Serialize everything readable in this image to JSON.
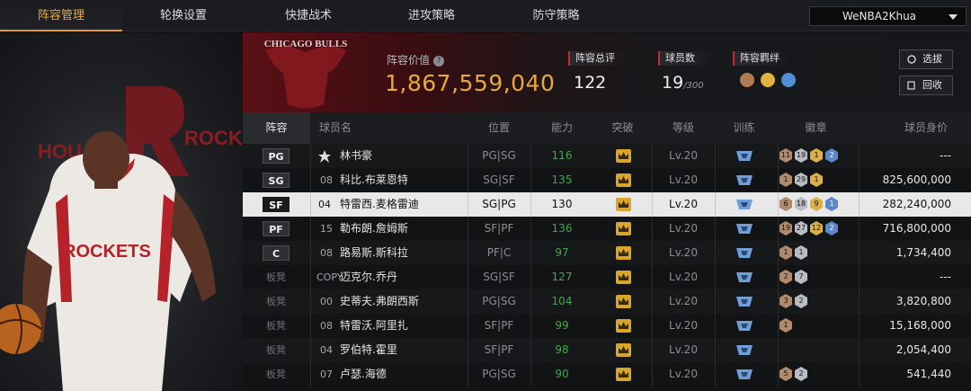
{
  "nav": {
    "tabs": [
      "阵容管理",
      "轮换设置",
      "快捷战术",
      "进攻策略",
      "防守策略"
    ],
    "active_index": 0,
    "user": "WeNBA2Khua"
  },
  "team": {
    "logo_text": "CHICAGO BULLS",
    "value_label": "阵容价值",
    "value": "1,867,559,040",
    "stats": [
      {
        "label": "阵容总评",
        "value": "122",
        "suffix": ""
      },
      {
        "label": "球员数",
        "value": "19",
        "suffix": "/300"
      },
      {
        "label": "阵容羁绊",
        "value": "",
        "suffix": ""
      }
    ],
    "buttons": {
      "select": "选拔",
      "recycle": "回收"
    }
  },
  "art": {
    "jersey_text": "ROCKETS",
    "banner_text_left": "HOU",
    "banner_text_right": "ROCK"
  },
  "table": {
    "headers": [
      "阵容",
      "球员名",
      "位置",
      "能力",
      "突破",
      "等级",
      "训练",
      "徽章",
      "球员身价"
    ],
    "rows": [
      {
        "slot": "PG",
        "num": "",
        "name": "林书豪",
        "pos": "PG|SG",
        "ability": "116",
        "level": "Lv.20",
        "price": "---",
        "badges": [
          [
            "b",
            "11"
          ],
          [
            "s",
            "19"
          ],
          [
            "g",
            "1"
          ],
          [
            "p",
            "2"
          ]
        ]
      },
      {
        "slot": "SG",
        "num": "08",
        "name": "科比.布莱恩特",
        "pos": "SG|SF",
        "ability": "135",
        "level": "Lv.20",
        "price": "825,600,000",
        "badges": [
          [
            "b",
            "1"
          ],
          [
            "s",
            "29"
          ],
          [
            "g",
            "1"
          ]
        ]
      },
      {
        "slot": "SF",
        "num": "04",
        "name": "特雷西.麦格雷迪",
        "pos": "SG|PG",
        "ability": "130",
        "level": "Lv.20",
        "price": "282,240,000",
        "badges": [
          [
            "b",
            "6"
          ],
          [
            "s",
            "18"
          ],
          [
            "g",
            "9"
          ],
          [
            "p",
            "1"
          ]
        ],
        "selected": true
      },
      {
        "slot": "PF",
        "num": "15",
        "name": "勒布朗.詹姆斯",
        "pos": "SF|PF",
        "ability": "136",
        "level": "Lv.20",
        "price": "716,800,000",
        "badges": [
          [
            "b",
            "19"
          ],
          [
            "s",
            "27"
          ],
          [
            "g",
            "12"
          ],
          [
            "p",
            "2"
          ]
        ]
      },
      {
        "slot": "C",
        "num": "08",
        "name": "路易斯.斯科拉",
        "pos": "PF|C",
        "ability": "97",
        "level": "Lv.20",
        "price": "1,734,400",
        "badges": [
          [
            "b",
            "1"
          ],
          [
            "s",
            "1"
          ]
        ]
      },
      {
        "slot": "板凳",
        "num": "COPY",
        "name": "迈克尔.乔丹",
        "pos": "SG|SF",
        "ability": "127",
        "level": "Lv.20",
        "price": "---",
        "badges": [
          [
            "b",
            "2"
          ],
          [
            "s",
            "7"
          ]
        ]
      },
      {
        "slot": "板凳",
        "num": "00",
        "name": "史蒂夫.弗朗西斯",
        "pos": "PG|SG",
        "ability": "104",
        "level": "Lv.20",
        "price": "3,820,800",
        "badges": [
          [
            "b",
            "3"
          ],
          [
            "s",
            "2"
          ]
        ]
      },
      {
        "slot": "板凳",
        "num": "08",
        "name": "特雷沃.阿里扎",
        "pos": "SF|PF",
        "ability": "99",
        "level": "Lv.20",
        "price": "15,168,000",
        "badges": [
          [
            "b",
            "1"
          ]
        ]
      },
      {
        "slot": "板凳",
        "num": "04",
        "name": "罗伯特.霍里",
        "pos": "SF|PF",
        "ability": "98",
        "level": "Lv.20",
        "price": "2,054,400",
        "badges": []
      },
      {
        "slot": "板凳",
        "num": "07",
        "name": "卢瑟.海德",
        "pos": "PG|SG",
        "ability": "90",
        "level": "Lv.20",
        "price": "541,440",
        "badges": [
          [
            "b",
            "5"
          ],
          [
            "s",
            "2"
          ]
        ]
      }
    ]
  },
  "colors": {
    "accent": "#e09a2f",
    "value": "#e8a93a",
    "ability": "#3ea84a",
    "stat_bar": "#c22b2b",
    "team_red": "#5a1016"
  },
  "icons": {
    "crown": "crown-icon",
    "training": "training-icon",
    "help": "help-icon",
    "caret": "chevron-down-icon"
  }
}
